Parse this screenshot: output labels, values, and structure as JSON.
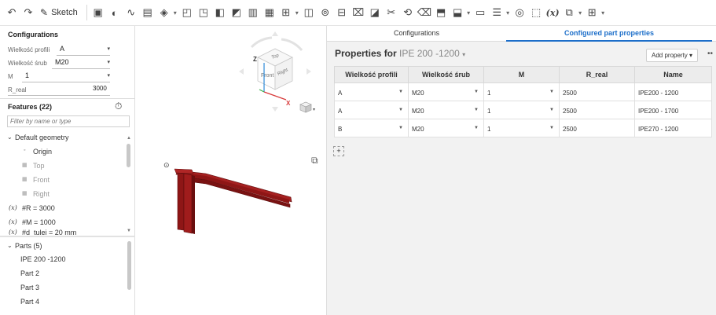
{
  "toolbar": {
    "sketch_label": "Sketch",
    "fx_label": "(x)"
  },
  "configurations": {
    "title": "Configurations",
    "inputs": [
      {
        "label": "Wielkość profili",
        "value": "A"
      },
      {
        "label": "Wielkość śrub",
        "value": "M20"
      },
      {
        "label": "M",
        "value": "1"
      },
      {
        "label": "R_real",
        "value": "3000"
      }
    ]
  },
  "features": {
    "title": "Features (22)",
    "filter_placeholder": "Filter by name or type",
    "group_label": "Default geometry",
    "items": [
      {
        "label": "Origin",
        "dim": false
      },
      {
        "label": "Top",
        "dim": true
      },
      {
        "label": "Front",
        "dim": true
      },
      {
        "label": "Right",
        "dim": true
      }
    ],
    "variables": [
      {
        "prefix": "(x)",
        "label": "#R = 3000"
      },
      {
        "prefix": "(x)",
        "label": "#M = 1000"
      },
      {
        "prefix": "(x)",
        "label": "#d_tulei = 20 mm"
      }
    ]
  },
  "parts": {
    "title": "Parts (5)",
    "items": [
      "IPE 200 -1200",
      "Part 2",
      "Part 3",
      "Part 4"
    ]
  },
  "viewcube": {
    "top": "Top",
    "front": "Front",
    "right": "Right",
    "axis_z": "Z",
    "axis_x": "X"
  },
  "right_panel": {
    "tabs": [
      "Configurations",
      "Configured part properties"
    ],
    "properties_label": "Properties for",
    "part_name": "IPE 200 -1200",
    "add_property_label": "Add property",
    "columns": [
      "Wielkość profili",
      "Wielkość śrub",
      "M",
      "R_real",
      "Name"
    ],
    "rows": [
      {
        "profile": "A",
        "screw": "M20",
        "m": "1",
        "r_real": "2500",
        "name": "IPE200 - 1200"
      },
      {
        "profile": "A",
        "screw": "M20",
        "m": "1",
        "r_real": "2500",
        "name": "IPE200 - 1700"
      },
      {
        "profile": "B",
        "screw": "M20",
        "m": "1",
        "r_real": "2500",
        "name": "IPE270 - 1200"
      }
    ]
  },
  "colors": {
    "accent": "#1c6ec9",
    "beam": "#8e1616",
    "beam_dark": "#5c0d0d"
  }
}
